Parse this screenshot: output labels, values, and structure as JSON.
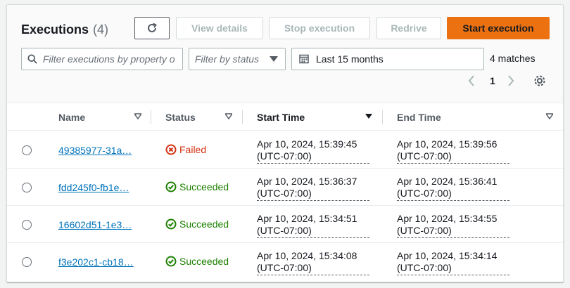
{
  "header": {
    "title": "Executions",
    "count": "(4)",
    "buttons": {
      "view_details": "View details",
      "stop_execution": "Stop execution",
      "redrive": "Redrive",
      "start_execution": "Start execution"
    },
    "search_placeholder": "Filter executions by property or value",
    "status_filter_placeholder": "Filter by status",
    "date_range": "Last 15 months",
    "matches": "4 matches",
    "page": "1"
  },
  "columns": {
    "name": "Name",
    "status": "Status",
    "start_time": "Start Time",
    "end_time": "End Time"
  },
  "rows": [
    {
      "name": "49385977-31a…",
      "status": "Failed",
      "start_line1": "Apr 10, 2024, 15:39:45",
      "start_line2": "(UTC-07:00)",
      "end_line1": "Apr 10, 2024, 15:39:56",
      "end_line2": "(UTC-07:00)"
    },
    {
      "name": "fdd245f0-fb1e…",
      "status": "Succeeded",
      "start_line1": "Apr 10, 2024, 15:36:37",
      "start_line2": "(UTC-07:00)",
      "end_line1": "Apr 10, 2024, 15:36:41",
      "end_line2": "(UTC-07:00)"
    },
    {
      "name": "16602d51-1e3…",
      "status": "Succeeded",
      "start_line1": "Apr 10, 2024, 15:34:51",
      "start_line2": "(UTC-07:00)",
      "end_line1": "Apr 10, 2024, 15:34:55",
      "end_line2": "(UTC-07:00)"
    },
    {
      "name": "f3e202c1-cb18…",
      "status": "Succeeded",
      "start_line1": "Apr 10, 2024, 15:34:08",
      "start_line2": "(UTC-07:00)",
      "end_line1": "Apr 10, 2024, 15:34:14",
      "end_line2": "(UTC-07:00)"
    }
  ],
  "colors": {
    "primary_button": "#ec7211",
    "link": "#0073bb",
    "failed": "#d13212",
    "succeeded": "#1d8102"
  }
}
